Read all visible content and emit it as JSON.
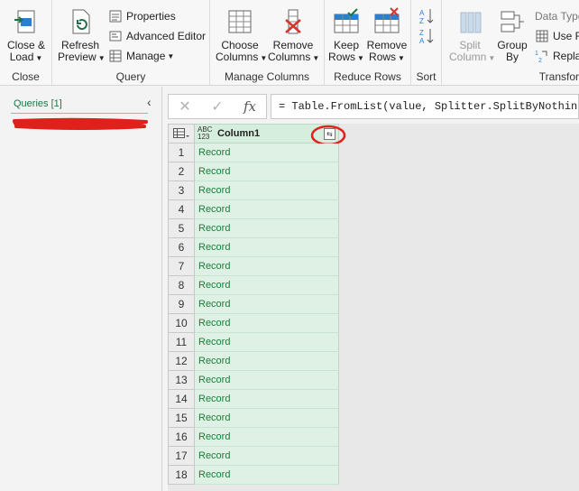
{
  "ribbon": {
    "close_group": {
      "label": "Close",
      "close_load": "Close &\nLoad",
      "close_load_l1": "Close &",
      "close_load_l2": "Load"
    },
    "query_group": {
      "label": "Query",
      "refresh_l1": "Refresh",
      "refresh_l2": "Preview",
      "properties": "Properties",
      "advanced_editor": "Advanced Editor",
      "manage": "Manage"
    },
    "manage_columns_group": {
      "label": "Manage Columns",
      "choose_l1": "Choose",
      "choose_l2": "Columns",
      "remove_l1": "Remove",
      "remove_l2": "Columns"
    },
    "reduce_rows_group": {
      "label": "Reduce Rows",
      "keep_l1": "Keep",
      "keep_l2": "Rows",
      "remove_l1": "Remove",
      "remove_l2": "Rows"
    },
    "sort_group": {
      "label": "Sort"
    },
    "transform_group": {
      "label": "Transfor",
      "split_l1": "Split",
      "split_l2": "Column",
      "group_l1": "Group",
      "group_l2": "By",
      "data_type": "Data Type",
      "use_first": "Use Fi",
      "replace": "Repla"
    }
  },
  "queries_pane": {
    "title": "Queries [1]"
  },
  "formula_bar": {
    "cancel_glyph": "✕",
    "confirm_glyph": "✓",
    "fx_glyph": "fx",
    "formula": "= Table.FromList(value, Splitter.SplitByNothing(),"
  },
  "grid": {
    "type_icon_top": "ABC",
    "type_icon_bottom": "123",
    "column_name": "Column1",
    "rows": [
      {
        "n": "1",
        "v": "Record"
      },
      {
        "n": "2",
        "v": "Record"
      },
      {
        "n": "3",
        "v": "Record"
      },
      {
        "n": "4",
        "v": "Record"
      },
      {
        "n": "5",
        "v": "Record"
      },
      {
        "n": "6",
        "v": "Record"
      },
      {
        "n": "7",
        "v": "Record"
      },
      {
        "n": "8",
        "v": "Record"
      },
      {
        "n": "9",
        "v": "Record"
      },
      {
        "n": "10",
        "v": "Record"
      },
      {
        "n": "11",
        "v": "Record"
      },
      {
        "n": "12",
        "v": "Record"
      },
      {
        "n": "13",
        "v": "Record"
      },
      {
        "n": "14",
        "v": "Record"
      },
      {
        "n": "15",
        "v": "Record"
      },
      {
        "n": "16",
        "v": "Record"
      },
      {
        "n": "17",
        "v": "Record"
      },
      {
        "n": "18",
        "v": "Record"
      }
    ]
  },
  "colors": {
    "accent_green": "#217346",
    "annotation_red": "#e0201b",
    "record_text": "#1e7b3a"
  }
}
